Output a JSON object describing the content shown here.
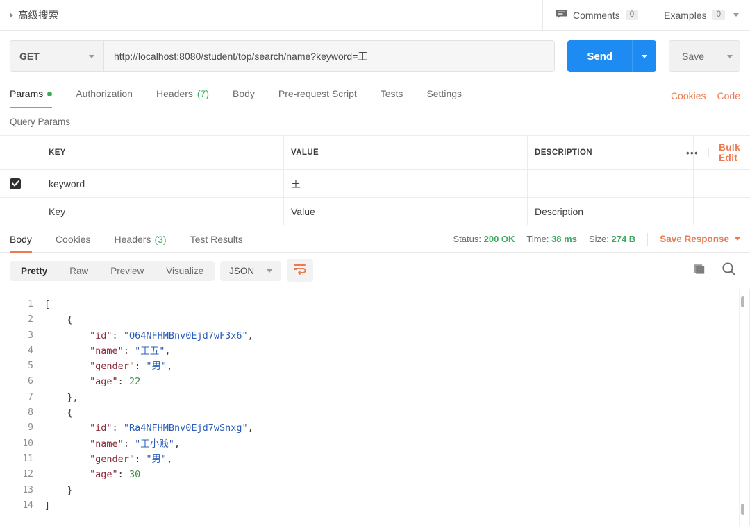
{
  "header": {
    "breadcrumb": "高级搜索",
    "comments_label": "Comments",
    "comments_count": "0",
    "examples_label": "Examples",
    "examples_count": "0"
  },
  "request": {
    "method": "GET",
    "url": "http://localhost:8080/student/top/search/name?keyword=王",
    "send_label": "Send",
    "save_label": "Save"
  },
  "request_tabs": {
    "items": [
      {
        "label": "Params",
        "active": true,
        "dot": true
      },
      {
        "label": "Authorization",
        "active": false
      },
      {
        "label": "Headers",
        "count": "(7)",
        "active": false
      },
      {
        "label": "Body",
        "active": false
      },
      {
        "label": "Pre-request Script",
        "active": false
      },
      {
        "label": "Tests",
        "active": false
      },
      {
        "label": "Settings",
        "active": false
      }
    ],
    "cookies_link": "Cookies",
    "code_link": "Code"
  },
  "query_params": {
    "title": "Query Params",
    "columns": [
      "KEY",
      "VALUE",
      "DESCRIPTION"
    ],
    "bulk_edit": "Bulk Edit",
    "more_dots": "•••",
    "rows": [
      {
        "checked": true,
        "key": "keyword",
        "value": "王",
        "description": ""
      }
    ],
    "placeholders": {
      "key": "Key",
      "value": "Value",
      "description": "Description"
    }
  },
  "response": {
    "tabs": [
      {
        "label": "Body",
        "active": true
      },
      {
        "label": "Cookies",
        "active": false
      },
      {
        "label": "Headers",
        "count": "(3)",
        "active": false
      },
      {
        "label": "Test Results",
        "active": false
      }
    ],
    "status_label": "Status:",
    "status_value": "200 OK",
    "time_label": "Time:",
    "time_value": "38 ms",
    "size_label": "Size:",
    "size_value": "274 B",
    "save_response": "Save Response"
  },
  "body_toolbar": {
    "views": [
      {
        "label": "Pretty",
        "active": true
      },
      {
        "label": "Raw",
        "active": false
      },
      {
        "label": "Preview",
        "active": false
      },
      {
        "label": "Visualize",
        "active": false
      }
    ],
    "format": "JSON"
  },
  "code": {
    "line_numbers": [
      "1",
      "2",
      "3",
      "4",
      "5",
      "6",
      "7",
      "8",
      "9",
      "10",
      "11",
      "12",
      "13",
      "14"
    ],
    "lines": [
      [
        {
          "t": "[",
          "c": "pun"
        }
      ],
      [
        {
          "t": "    {",
          "c": "pun"
        }
      ],
      [
        {
          "t": "        ",
          "c": "pun"
        },
        {
          "t": "\"id\"",
          "c": "key"
        },
        {
          "t": ": ",
          "c": "pun"
        },
        {
          "t": "\"Q64NFHMBnv0Ejd7wF3x6\"",
          "c": "str"
        },
        {
          "t": ",",
          "c": "pun"
        }
      ],
      [
        {
          "t": "        ",
          "c": "pun"
        },
        {
          "t": "\"name\"",
          "c": "key"
        },
        {
          "t": ": ",
          "c": "pun"
        },
        {
          "t": "\"王五\"",
          "c": "str"
        },
        {
          "t": ",",
          "c": "pun"
        }
      ],
      [
        {
          "t": "        ",
          "c": "pun"
        },
        {
          "t": "\"gender\"",
          "c": "key"
        },
        {
          "t": ": ",
          "c": "pun"
        },
        {
          "t": "\"男\"",
          "c": "str"
        },
        {
          "t": ",",
          "c": "pun"
        }
      ],
      [
        {
          "t": "        ",
          "c": "pun"
        },
        {
          "t": "\"age\"",
          "c": "key"
        },
        {
          "t": ": ",
          "c": "pun"
        },
        {
          "t": "22",
          "c": "num"
        }
      ],
      [
        {
          "t": "    },",
          "c": "pun"
        }
      ],
      [
        {
          "t": "    {",
          "c": "pun"
        }
      ],
      [
        {
          "t": "        ",
          "c": "pun"
        },
        {
          "t": "\"id\"",
          "c": "key"
        },
        {
          "t": ": ",
          "c": "pun"
        },
        {
          "t": "\"Ra4NFHMBnv0Ejd7wSnxg\"",
          "c": "str"
        },
        {
          "t": ",",
          "c": "pun"
        }
      ],
      [
        {
          "t": "        ",
          "c": "pun"
        },
        {
          "t": "\"name\"",
          "c": "key"
        },
        {
          "t": ": ",
          "c": "pun"
        },
        {
          "t": "\"王小贱\"",
          "c": "str"
        },
        {
          "t": ",",
          "c": "pun"
        }
      ],
      [
        {
          "t": "        ",
          "c": "pun"
        },
        {
          "t": "\"gender\"",
          "c": "key"
        },
        {
          "t": ": ",
          "c": "pun"
        },
        {
          "t": "\"男\"",
          "c": "str"
        },
        {
          "t": ",",
          "c": "pun"
        }
      ],
      [
        {
          "t": "        ",
          "c": "pun"
        },
        {
          "t": "\"age\"",
          "c": "key"
        },
        {
          "t": ": ",
          "c": "pun"
        },
        {
          "t": "30",
          "c": "num"
        }
      ],
      [
        {
          "t": "    }",
          "c": "pun"
        }
      ],
      [
        {
          "t": "]",
          "c": "pun"
        }
      ]
    ]
  },
  "colors": {
    "accent_orange": "#ec7b52",
    "send_blue": "#1d8bf1",
    "status_green": "#3aab5b",
    "json_key": "#8b2d3c",
    "json_string": "#2b5cb8",
    "json_number": "#3f8f46"
  }
}
